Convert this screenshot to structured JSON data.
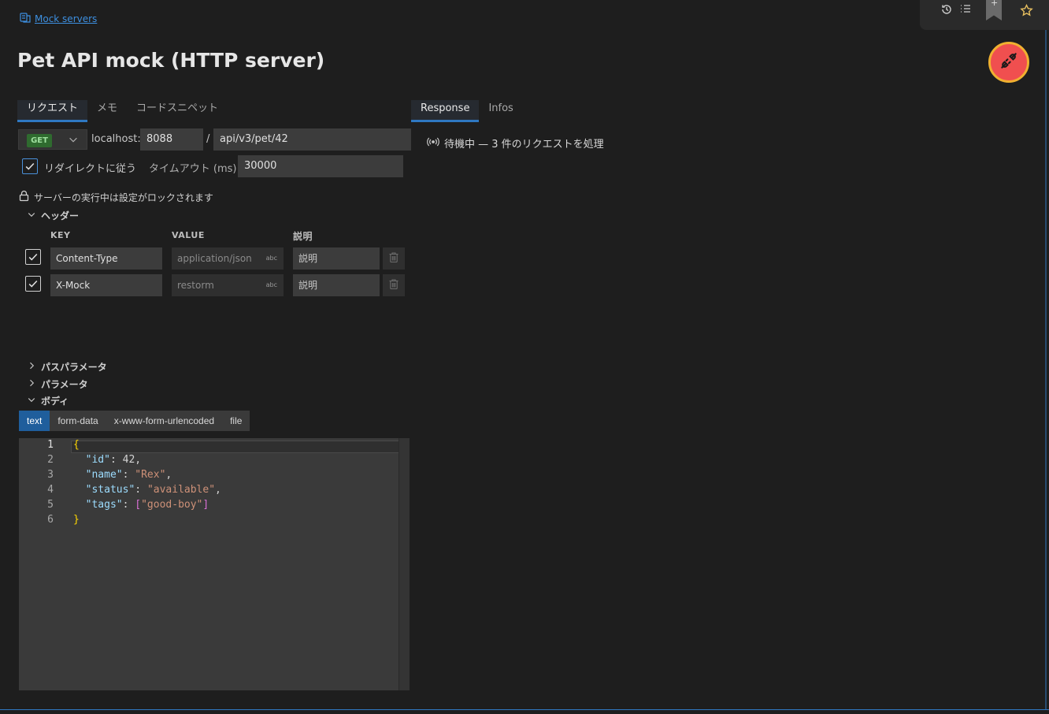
{
  "breadcrumb": {
    "label": "Mock servers"
  },
  "page": {
    "title": "Pet API mock (HTTP server)"
  },
  "left_tabs": [
    {
      "label": "リクエスト",
      "active": true
    },
    {
      "label": "メモ",
      "active": false
    },
    {
      "label": "コードスニペット",
      "active": false
    }
  ],
  "right_tabs": [
    {
      "label": "Response",
      "active": true
    },
    {
      "label": "Infos",
      "active": false
    }
  ],
  "request": {
    "method": "GET",
    "host_label": "localhost:",
    "port": "8088",
    "separator": "/",
    "path": "api/v3/pet/42",
    "redirect_label": "リダイレクトに従う",
    "redirect_checked": true,
    "timeout_label": "タイムアウト (ms)",
    "timeout_value": "30000",
    "lock_notice": "サーバーの実行中は設定がロックされます"
  },
  "status": {
    "text": "待機中 — 3 件のリクエストを処理"
  },
  "headers": {
    "section_label": "ヘッダー",
    "columns": {
      "key": "KEY",
      "value": "VALUE",
      "description": "説明"
    },
    "rows": [
      {
        "checked": true,
        "key": "Content-Type",
        "value": "application/json",
        "value_type": "abc",
        "description": "説明"
      },
      {
        "checked": true,
        "key": "X-Mock",
        "value": "restorm",
        "value_type": "abc",
        "description": "説明"
      }
    ]
  },
  "sections": {
    "path_params": "パスパラメータ",
    "params": "パラメータ",
    "body": "ボディ"
  },
  "body_tabs": [
    {
      "label": "text",
      "active": true
    },
    {
      "label": "form-data",
      "active": false
    },
    {
      "label": "x-www-form-urlencoded",
      "active": false
    },
    {
      "label": "file",
      "active": false
    }
  ],
  "editor": {
    "line_numbers": [
      "1",
      "2",
      "3",
      "4",
      "5",
      "6"
    ],
    "lines": [
      "{",
      "  \"id\": 42,",
      "  \"name\": \"Rex\",",
      "  \"status\": \"available\",",
      "  \"tags\": [\"good-boy\"]",
      "}"
    ]
  },
  "colors": {
    "accent": "#2f78c2",
    "link": "#3d8fe0",
    "connect_button": "#f04f4f",
    "connect_ring": "#f0b030",
    "method_get": "#2f6b2f"
  },
  "icons": {
    "breadcrumb": "server-icon",
    "history": "history-icon",
    "list": "list-icon",
    "bookmark": "bookmark-add-icon",
    "star": "star-icon",
    "connect": "plug-disconnected-icon",
    "lock": "lock-icon",
    "broadcast": "broadcast-icon"
  },
  "bookmark_plus": "+"
}
